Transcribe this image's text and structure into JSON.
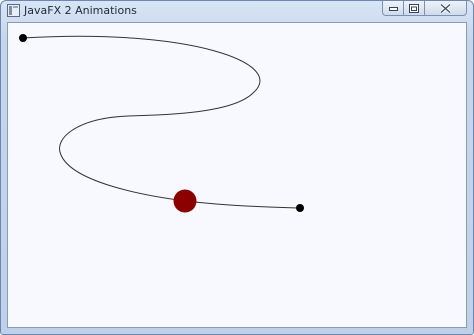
{
  "window": {
    "title": "JavaFX 2 Animations",
    "caption_buttons": [
      {
        "name": "minimize",
        "icon": "minimize-icon"
      },
      {
        "name": "maximize",
        "icon": "maximize-icon"
      },
      {
        "name": "close",
        "icon": "close-icon"
      }
    ]
  },
  "scene": {
    "background_color": "#f8f9ff",
    "path_color": "#333333",
    "endpoint_color": "#000000",
    "moving_circle_color": "#8b0000"
  }
}
